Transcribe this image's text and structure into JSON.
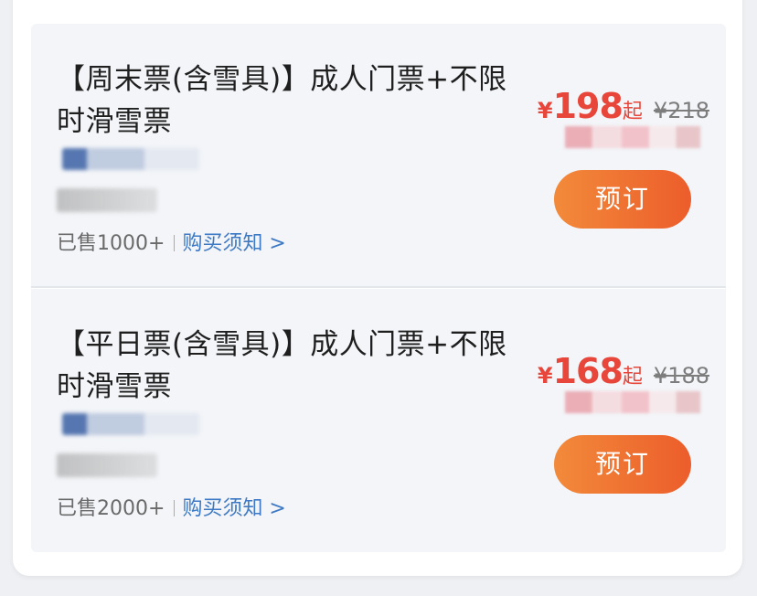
{
  "tickets": [
    {
      "title": "【周末票(含雪具)】成人门票+不限时滑雪票",
      "currency": "¥",
      "price": "198",
      "price_suffix": "起",
      "original_price": "¥218",
      "sold": "已售1000+",
      "notice_link": "购买须知 >",
      "book_label": "预订"
    },
    {
      "title": "【平日票(含雪具)】成人门票+不限时滑雪票",
      "currency": "¥",
      "price": "168",
      "price_suffix": "起",
      "original_price": "¥188",
      "sold": "已售2000+",
      "notice_link": "购买须知 >",
      "book_label": "预订"
    }
  ],
  "colors": {
    "price": "#e8463a",
    "button_start": "#f28a3a",
    "button_end": "#ec5d2b",
    "link": "#3d79c4"
  }
}
